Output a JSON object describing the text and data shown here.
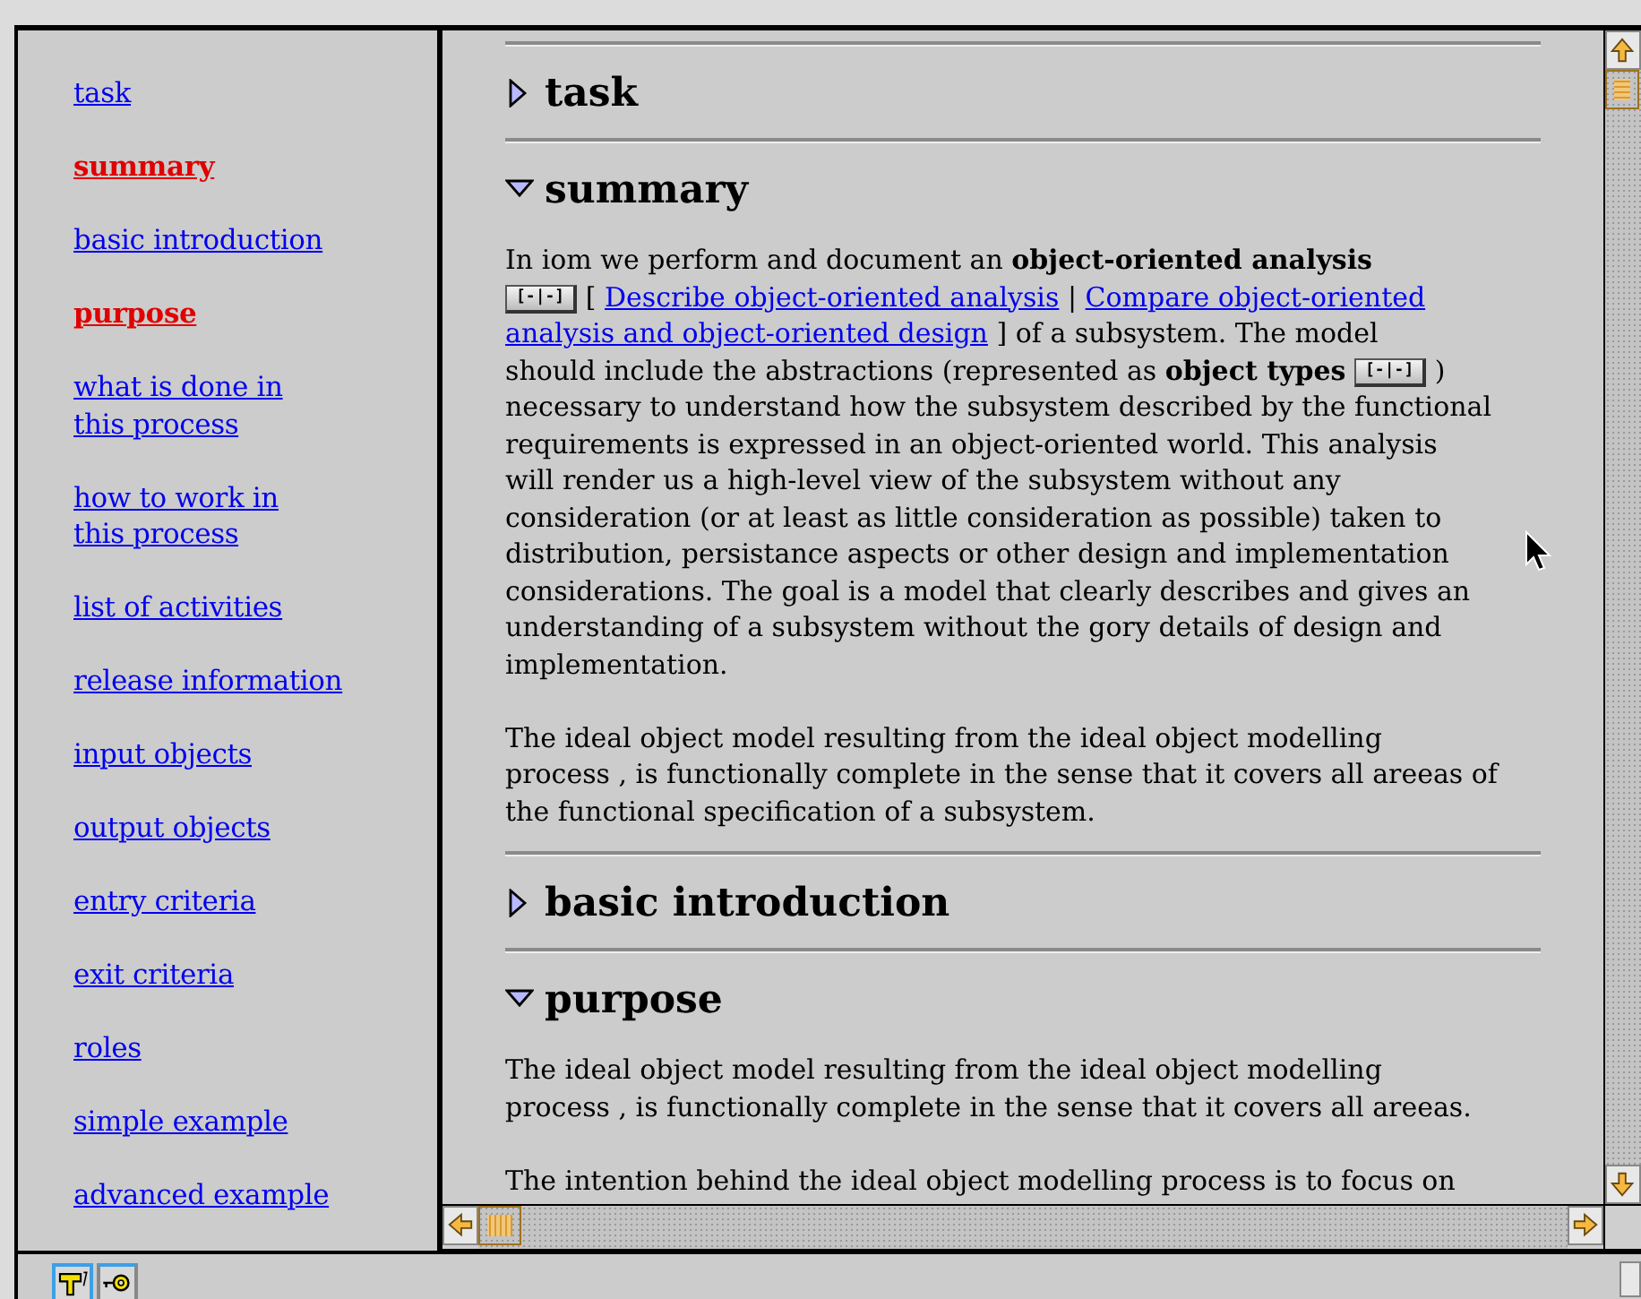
{
  "navigation": {
    "items": [
      {
        "label": "task",
        "selected": false
      },
      {
        "label": "summary",
        "selected": true
      },
      {
        "label": "basic introduction",
        "selected": false
      },
      {
        "label": "purpose",
        "selected": true
      },
      {
        "label": "what is done in\nthis process",
        "selected": false
      },
      {
        "label": "how to work in\nthis process",
        "selected": false
      },
      {
        "label": "list of activities",
        "selected": false
      },
      {
        "label": "release information",
        "selected": false
      },
      {
        "label": "input objects",
        "selected": false
      },
      {
        "label": "output objects",
        "selected": false
      },
      {
        "label": "entry criteria",
        "selected": false
      },
      {
        "label": "exit criteria",
        "selected": false
      },
      {
        "label": "roles",
        "selected": false
      },
      {
        "label": "simple example",
        "selected": false
      },
      {
        "label": "advanced example",
        "selected": false
      }
    ]
  },
  "sections": [
    {
      "title": "task",
      "expanded": false
    },
    {
      "title": "summary",
      "expanded": true,
      "paragraphs": [
        [
          {
            "kind": "text",
            "text": "In iom we perform and document an **object-oriented analysis**\n"
          },
          {
            "kind": "button",
            "label": "[-|-]"
          },
          {
            "kind": "text",
            "text": " [ "
          },
          {
            "kind": "link",
            "text": "Describe object-oriented analysis"
          },
          {
            "kind": "text",
            "text": " | "
          },
          {
            "kind": "link",
            "text": "Compare object-oriented"
          },
          {
            "kind": "break"
          },
          {
            "kind": "link",
            "text": "analysis and object-oriented design"
          },
          {
            "kind": "text",
            "text": " ] of a subsystem. The model\nshould include the abstractions (represented as **object types** "
          },
          {
            "kind": "button",
            "label": "[-|-]"
          },
          {
            "kind": "text",
            "text": " )\nnecessary to understand how the subsystem described by the functional\nrequirements is expressed in an object-oriented world. This analysis\nwill render us a high-level view of the subsystem without any\nconsideration (or at least as little consideration as possible) taken to\ndistribution, persistance aspects or other design and implementation\nconsiderations. The goal is a model that clearly describes and gives an\nunderstanding of a subsystem without the gory details of design and\nimplementation."
          }
        ],
        [
          {
            "kind": "text",
            "text": "The ideal object model resulting from the ideal object modelling\nprocess , is functionally complete in the sense that it covers all areeas of\nthe functional specification of a subsystem."
          }
        ]
      ]
    },
    {
      "title": "basic introduction",
      "expanded": false
    },
    {
      "title": "purpose",
      "expanded": true,
      "paragraphs": [
        [
          {
            "kind": "text",
            "text": "The ideal object model resulting from the ideal object modelling\nprocess , is functionally complete in the sense that it covers all areeas."
          }
        ],
        [
          {
            "kind": "text",
            "text": "The intention behind the ideal object modelling process is to focus on"
          }
        ]
      ]
    }
  ]
}
